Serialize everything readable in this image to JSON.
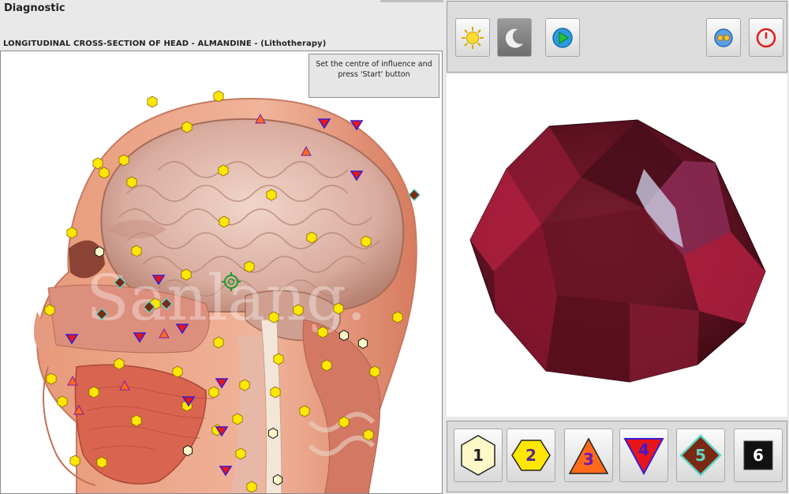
{
  "window": {
    "title": "Diagnostic"
  },
  "view": {
    "subtitle": "LONGITUDINAL CROSS-SECTION OF HEAD - ALMANDINE - (Lithotherapy)",
    "hint_text": "Set the centre of influence and press 'Start' button",
    "watermark": "Sanlang."
  },
  "toolbar": {
    "buttons": [
      {
        "name": "day-mode",
        "icon": "sun-icon"
      },
      {
        "name": "night-mode",
        "icon": "moon-icon"
      },
      {
        "name": "start",
        "icon": "play-icon"
      },
      {
        "name": "settings",
        "icon": "reels-icon"
      },
      {
        "name": "power",
        "icon": "power-icon"
      }
    ]
  },
  "markers": {
    "colors": {
      "1": "#fdf8c8",
      "2": "#ffe700",
      "3": "#ff6a1a",
      "4": "#3a1cd0",
      "5": "#7a2a14",
      "6": "#111111"
    },
    "yellow_hexagons": 54,
    "white_hexagons": 6,
    "orange_triangles": 6,
    "blue_triangles": 13,
    "brown_diamonds": 6
  },
  "scale_buttons": [
    {
      "label": "1",
      "shape": "hexagon",
      "fill": "#fdf8c8",
      "text_color": "#222222"
    },
    {
      "label": "2",
      "shape": "hexagon",
      "fill": "#ffe700",
      "text_color": "#5a2a8a"
    },
    {
      "label": "3",
      "shape": "triangle-up",
      "fill": "#ff6a1a",
      "text_color": "#6a1ab0"
    },
    {
      "label": "4",
      "shape": "triangle-down",
      "fill": "#e8151a",
      "text_color": "#3a1cd0"
    },
    {
      "label": "5",
      "shape": "diamond",
      "fill": "#7a2a14",
      "text_color": "#5fd6c8"
    },
    {
      "label": "6",
      "shape": "square",
      "fill": "#111111",
      "text_color": "#ffffff"
    }
  ]
}
